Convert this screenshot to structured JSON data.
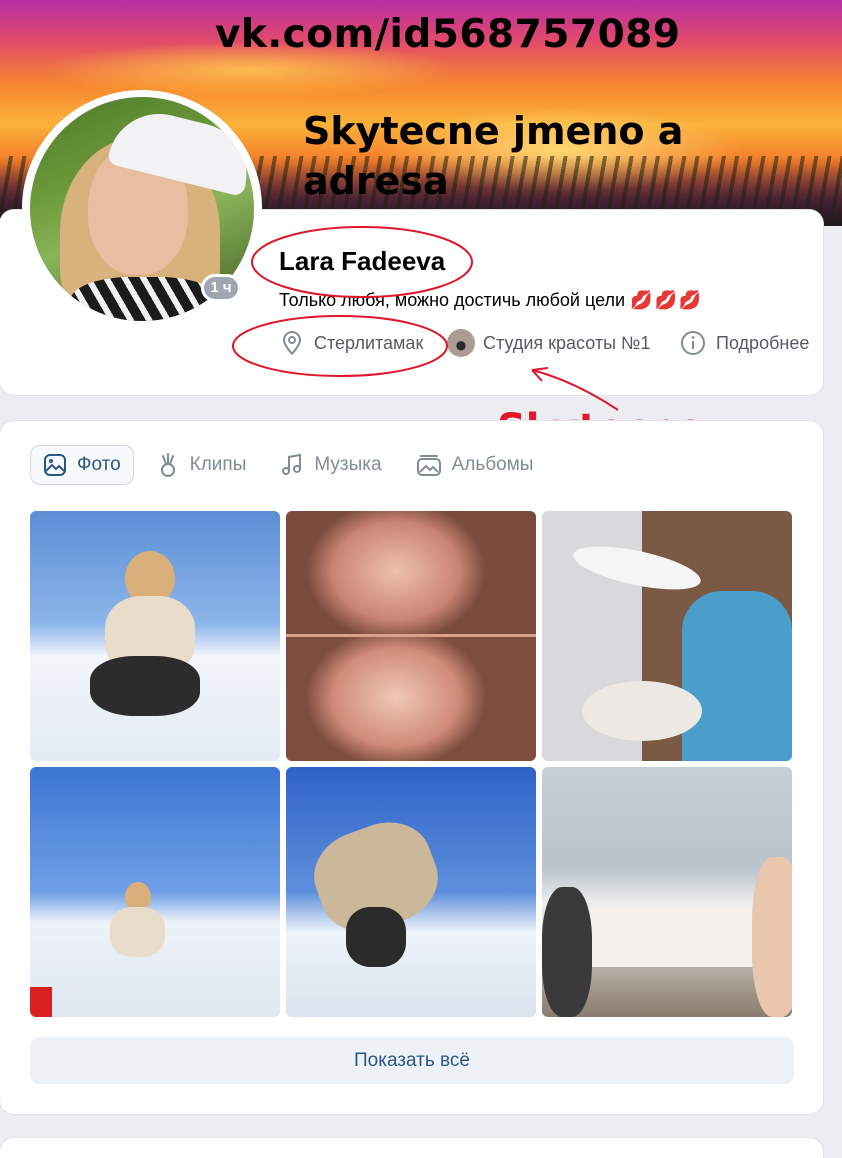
{
  "cover": {
    "url_text": "vk.com/id568757089",
    "note_text": "Skytecne jmeno a adresa"
  },
  "profile": {
    "name": "Lara Fadeeva",
    "status": "Только любя, можно достичь любой цели",
    "status_emoji": "💋💋💋",
    "online_badge": "1 ч",
    "city": "Стерлитамак",
    "work": "Студия красоты №1",
    "more": "Подробнее"
  },
  "annotation": {
    "work_label": "Skytecne Prace",
    "color": "#e0162b"
  },
  "tabs": [
    {
      "label": "Фото",
      "icon": "photo-icon",
      "active": true
    },
    {
      "label": "Клипы",
      "icon": "clips-icon",
      "active": false
    },
    {
      "label": "Музыка",
      "icon": "music-note-icon",
      "active": false
    },
    {
      "label": "Альбомы",
      "icon": "albums-icon",
      "active": false
    }
  ],
  "photos_count_shown": 6,
  "show_all_label": "Показать всё",
  "colors": {
    "link": "#2a5885",
    "muted": "#818c99",
    "page_bg": "#ebedf0"
  }
}
